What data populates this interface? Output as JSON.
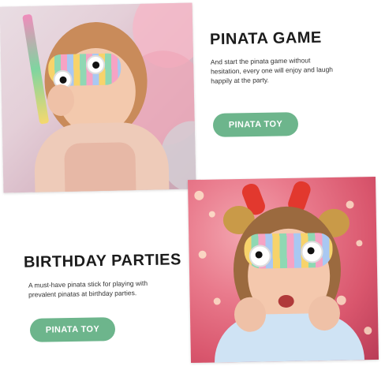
{
  "sections": [
    {
      "title": "PINATA GAME",
      "description_line1": "And start the pinata game without",
      "description_line2": "hesitation, every one will enjoy and laugh",
      "description_line3": "happily at the party.",
      "button_label": "PINATA TOY"
    },
    {
      "title": "BIRTHDAY PARTIES",
      "description_line1": "A must-have pinata stick for playing with",
      "description_line2": "prevalent pinatas at birthday parties.",
      "button_label": "PINATA TOY"
    }
  ],
  "colors": {
    "button": "#6db58c",
    "title": "#1b1b1b",
    "text": "#333333"
  }
}
